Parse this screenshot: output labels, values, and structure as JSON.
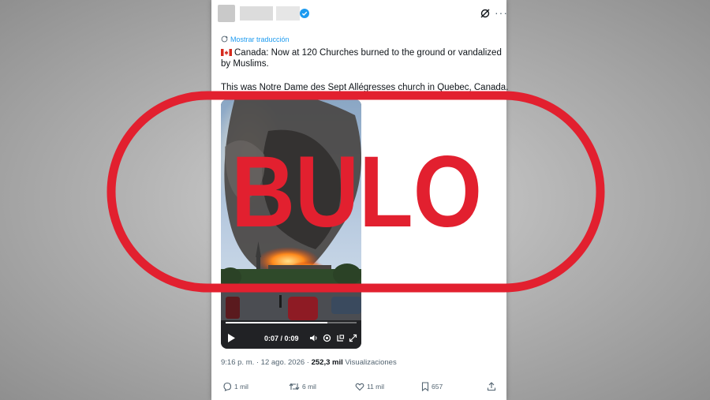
{
  "tweet": {
    "translate_label": "Mostrar traducción",
    "line1": "Canada: Now at 120 Churches burned to the ground or vandalized by Muslims.",
    "line2": "This was Notre Dame des Sept Allégresses church in Quebec, Canada.",
    "time": "9:16 p. m. · 12 ago. 2026 · ",
    "views_count": "252,3 mil",
    "views_label": " Visualizaciones"
  },
  "video": {
    "time_display": "0:07 / 0:09",
    "progress": 0.78
  },
  "actions": {
    "replies": "1 mil",
    "reposts": "6 mil",
    "likes": "11 mil",
    "bookmarks": "657"
  },
  "stamp": {
    "text": "BULO",
    "color": "#e2202f"
  },
  "icons": [
    "verified-icon",
    "grok-icon",
    "more-icon",
    "translate-icon",
    "flag-canada-icon",
    "play-icon",
    "volume-icon",
    "settings-icon",
    "pip-icon",
    "fullscreen-icon",
    "reply-icon",
    "repost-icon",
    "like-icon",
    "bookmark-icon",
    "share-icon"
  ]
}
